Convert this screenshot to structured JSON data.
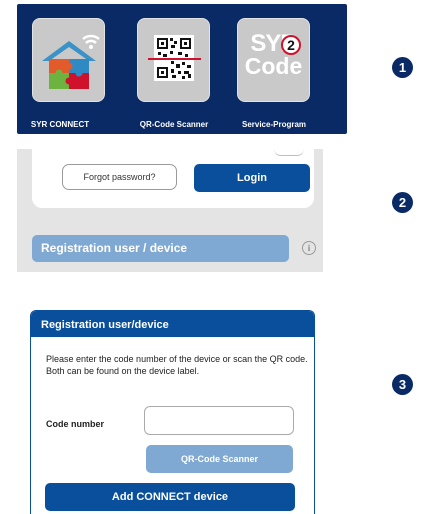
{
  "panel1": {
    "tiles": [
      {
        "label": "SYR CONNECT",
        "icon": "house-puzzle-wifi-icon"
      },
      {
        "label": "QR-Code Scanner",
        "icon": "qr-code-icon"
      },
      {
        "label": "Service-Program",
        "icon": "syr-code-logo"
      }
    ],
    "logo_syr": "SYR",
    "logo_code": "Code",
    "logo_badge": "2"
  },
  "steps": [
    "1",
    "2",
    "3"
  ],
  "panel2": {
    "forgot_label": "Forgot password?",
    "login_label": "Login",
    "registration_label": "Registration user / device",
    "info_icon": "i"
  },
  "panel3": {
    "title": "Registration user/device",
    "instructions": "Please enter the code number of the device or scan the QR code. Both can be found on the device label.",
    "code_label": "Code number",
    "code_value": "",
    "qr_button": "QR-Code Scanner",
    "add_button": "Add CONNECT device"
  },
  "colors": {
    "navy": "#0a2a66",
    "brand_blue": "#0a4f9c",
    "light_blue": "#7fa8d2",
    "grey_bg": "#e4e4e4",
    "red_accent": "#d0112b"
  }
}
